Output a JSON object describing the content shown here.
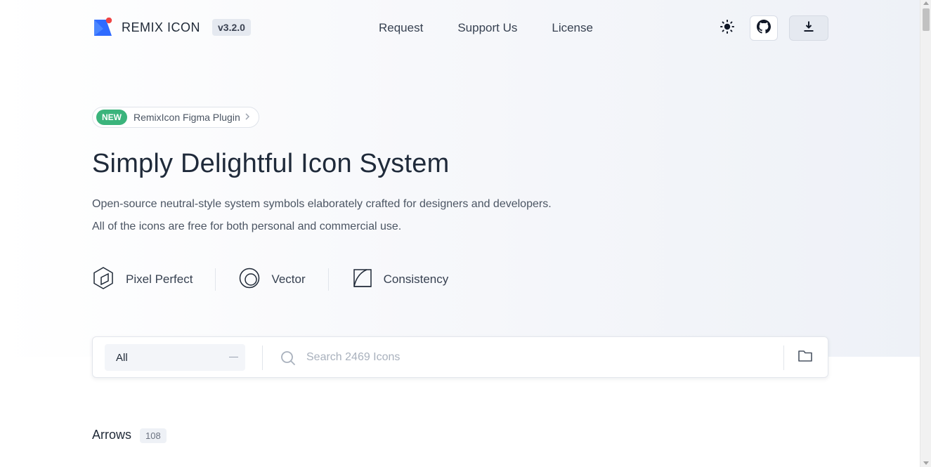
{
  "header": {
    "logo_name": "REMIX ICON",
    "version": "v3.2.0",
    "nav": [
      {
        "label": "Request"
      },
      {
        "label": "Support Us"
      },
      {
        "label": "License"
      }
    ],
    "icons": {
      "theme": "sun-icon",
      "github": "github-icon",
      "download": "download-icon"
    }
  },
  "hero": {
    "plugin_badge": "NEW",
    "plugin_text": "RemixIcon Figma Plugin",
    "title": "Simply Delightful Icon System",
    "desc_line1": "Open-source neutral-style system symbols elaborately crafted for designers and developers.",
    "desc_line2": "All of the icons are free for both personal and commercial use.",
    "features": [
      {
        "label": "Pixel Perfect",
        "icon": "cube-icon"
      },
      {
        "label": "Vector",
        "icon": "circles-icon"
      },
      {
        "label": "Consistency",
        "icon": "grid-curve-icon"
      }
    ]
  },
  "search": {
    "category_value": "All",
    "placeholder": "Search 2469 Icons",
    "value": ""
  },
  "section": {
    "title": "Arrows",
    "count": "108"
  },
  "colors": {
    "brand_blue": "#2f6bff",
    "brand_red": "#ef4444",
    "new_badge": "#3bb47c",
    "text_dark": "#1f2a3a"
  }
}
